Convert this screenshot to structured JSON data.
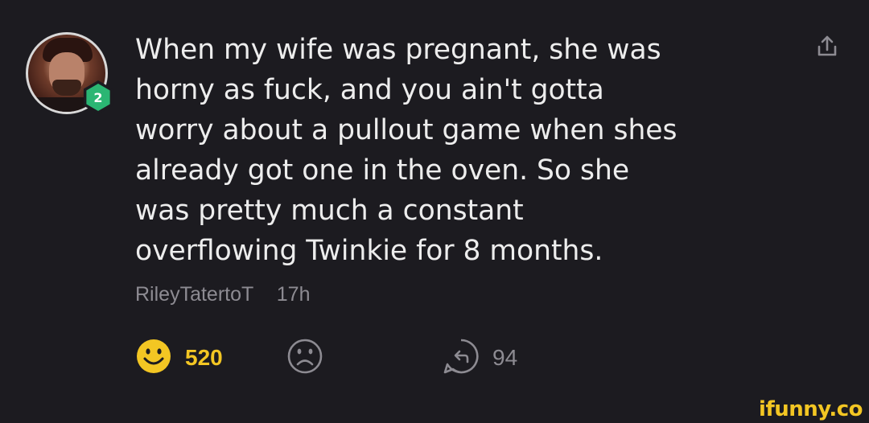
{
  "comment": {
    "lines": [
      "When my wife was pregnant, she was",
      "horny as fuck, and you ain't gotta",
      "worry about a pullout game when shes",
      "already got one in the oven. So she",
      "was pretty much a constant",
      "overflowing Twinkie for 8 months."
    ],
    "author": "RileyTatertoT",
    "time": "17h",
    "badge_level": "2"
  },
  "actions": {
    "smile_count": "520",
    "reply_count": "94"
  },
  "icons": {
    "share": "share-icon",
    "smile": "smile-icon",
    "frown": "frown-icon",
    "reply": "reply-icon"
  },
  "colors": {
    "background": "#1c1b20",
    "text": "#ededed",
    "muted": "#8d8b92",
    "accent_yellow": "#f3c623",
    "badge_green": "#2bb673"
  },
  "watermark": "ifunny.co"
}
